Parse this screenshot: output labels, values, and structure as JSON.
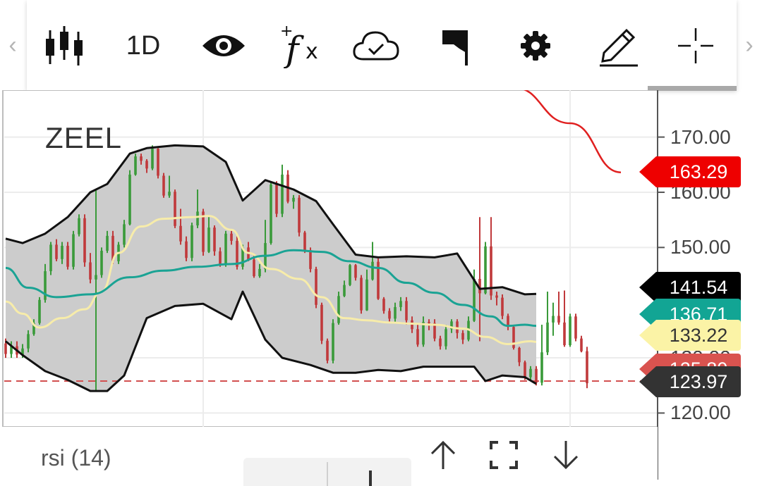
{
  "toolbar": {
    "timeframe": "1D",
    "items": [
      {
        "name": "chart-type-candles-icon"
      },
      {
        "name": "timeframe-button"
      },
      {
        "name": "visibility-eye-icon"
      },
      {
        "name": "add-indicator-fx-icon"
      },
      {
        "name": "cloud-saved-icon"
      },
      {
        "name": "flag-icon"
      },
      {
        "name": "settings-gear-icon"
      },
      {
        "name": "draw-pencil-icon"
      },
      {
        "name": "crosshair-icon"
      }
    ]
  },
  "symbol": "ZEEL",
  "bottom": {
    "indicator_label": "rsi (14)"
  },
  "colors": {
    "band_fill": "#cccccc",
    "band_line": "#111111",
    "ma_teal": "#1aa394",
    "ma_yellow": "#f7ecaa",
    "up": "#3a9a3a",
    "down": "#c0393b",
    "red_line": "#e02020",
    "dashed": "#d25050"
  },
  "chart_data": {
    "type": "candlestick",
    "symbol": "ZEEL",
    "timeframe": "1D",
    "ylim": [
      117.5,
      178.5
    ],
    "y_ticks": [
      "170.00",
      "160.00",
      "150.00",
      "130.00",
      "120.00"
    ],
    "y_tick_values": [
      170,
      160,
      150,
      130,
      120
    ],
    "grid": true,
    "price_tags": [
      {
        "label": "163.29",
        "value": 163.29,
        "bg": "#ee0000",
        "fg": "#ffffff"
      },
      {
        "label": "141.54",
        "value": 141.54,
        "bg": "#000000",
        "fg": "#ffffff"
      },
      {
        "label": "136.71",
        "value": 136.71,
        "bg": "#12a594",
        "fg": "#ffffff"
      },
      {
        "label": "133.22",
        "value": 133.22,
        "bg": "#fbf3a6",
        "fg": "#333333"
      },
      {
        "label": "125.80",
        "value": 125.8,
        "bg": "#d9534f",
        "fg": "#ffffff"
      },
      {
        "label": "123.97",
        "value": 123.97,
        "bg": "#333333",
        "fg": "#ffffff"
      }
    ],
    "dashed_level": 125.8,
    "red_ma": [
      [
        90,
        179
      ],
      [
        100,
        172.5
      ],
      [
        109,
        163.6
      ]
    ],
    "bb_upper": [
      [
        0,
        151.6
      ],
      [
        3,
        150.8
      ],
      [
        7,
        152.5
      ],
      [
        11,
        155.5
      ],
      [
        15,
        160
      ],
      [
        18,
        161.5
      ],
      [
        22,
        167
      ],
      [
        25,
        168
      ],
      [
        30,
        168.5
      ],
      [
        35,
        168.3
      ],
      [
        39,
        165.5
      ],
      [
        42,
        158.5
      ],
      [
        46,
        162.2
      ],
      [
        51,
        160.5
      ],
      [
        55,
        158.4
      ],
      [
        58,
        154.2
      ],
      [
        62,
        148.7
      ],
      [
        66,
        148.2
      ],
      [
        71,
        148.4
      ],
      [
        76,
        148.2
      ],
      [
        80,
        148.9
      ],
      [
        84,
        142.5
      ],
      [
        88,
        142.8
      ],
      [
        92,
        141.5
      ],
      [
        94,
        141.6
      ]
    ],
    "bb_lower": [
      [
        0,
        133
      ],
      [
        3,
        130.5
      ],
      [
        7,
        127.6
      ],
      [
        11,
        126
      ],
      [
        15,
        124
      ],
      [
        18,
        124
      ],
      [
        21,
        126.8
      ],
      [
        25,
        137.2
      ],
      [
        30,
        139.4
      ],
      [
        35,
        139.8
      ],
      [
        40,
        137
      ],
      [
        42,
        142
      ],
      [
        46,
        133.3
      ],
      [
        49,
        130
      ],
      [
        54,
        128.7
      ],
      [
        58,
        127.3
      ],
      [
        62,
        127.3
      ],
      [
        66,
        127.8
      ],
      [
        70,
        127.6
      ],
      [
        74,
        128.4
      ],
      [
        80,
        128.4
      ],
      [
        83,
        128.4
      ],
      [
        85,
        125.8
      ],
      [
        88,
        126.8
      ],
      [
        92,
        126.5
      ],
      [
        94,
        125.3
      ]
    ],
    "ma_teal": [
      [
        0,
        146.3
      ],
      [
        4,
        142.7
      ],
      [
        9,
        141
      ],
      [
        15,
        141.5
      ],
      [
        22,
        144.6
      ],
      [
        28,
        145.8
      ],
      [
        34,
        146.5
      ],
      [
        40,
        147
      ],
      [
        46,
        148.5
      ],
      [
        51,
        149.5
      ],
      [
        56,
        149.2
      ],
      [
        61,
        147.5
      ],
      [
        66,
        146.3
      ],
      [
        71,
        143.6
      ],
      [
        76,
        141.8
      ],
      [
        81,
        139.6
      ],
      [
        86,
        137.5
      ],
      [
        89,
        135.8
      ],
      [
        92,
        136
      ],
      [
        94,
        135.8
      ]
    ],
    "ma_yellow": [
      [
        0,
        140.2
      ],
      [
        3,
        138
      ],
      [
        6,
        135.5
      ],
      [
        10,
        137.2
      ],
      [
        14,
        138.8
      ],
      [
        17,
        142
      ],
      [
        20,
        149
      ],
      [
        24,
        153.8
      ],
      [
        28,
        155.2
      ],
      [
        33,
        155.5
      ],
      [
        36,
        155.7
      ],
      [
        40,
        153.2
      ],
      [
        43,
        149
      ],
      [
        47,
        146.1
      ],
      [
        52,
        144.3
      ],
      [
        56,
        141
      ],
      [
        60,
        137.2
      ],
      [
        64,
        136.8
      ],
      [
        68,
        136.4
      ],
      [
        72,
        136.2
      ],
      [
        76,
        136
      ],
      [
        81,
        135.3
      ],
      [
        85,
        133.8
      ],
      [
        89,
        132.5
      ],
      [
        93,
        133
      ],
      [
        94,
        132.9
      ]
    ],
    "candles": [
      [
        0,
        132.6,
        130.7,
        133.5,
        130
      ],
      [
        1,
        130.7,
        132.1,
        133,
        130
      ],
      [
        2,
        132.1,
        130.6,
        133,
        130
      ],
      [
        3,
        130.6,
        131.7,
        132.5,
        130
      ],
      [
        4,
        131.7,
        134.3,
        135,
        131
      ],
      [
        5,
        134.3,
        136.3,
        137,
        134
      ],
      [
        6,
        136.3,
        140.5,
        141,
        136
      ],
      [
        7,
        140.5,
        145.7,
        147,
        140
      ],
      [
        8,
        145.7,
        150.5,
        151,
        145
      ],
      [
        9,
        150.5,
        147.9,
        151.5,
        147.5
      ],
      [
        10,
        147.9,
        150.3,
        151,
        147
      ],
      [
        11,
        150.3,
        146.5,
        151,
        146
      ],
      [
        12,
        146.5,
        152.4,
        153,
        146
      ],
      [
        13,
        152.4,
        155.3,
        156,
        152
      ],
      [
        14,
        155.3,
        147.3,
        156,
        146.5
      ],
      [
        15,
        147.3,
        144.2,
        149,
        143.5
      ],
      [
        16,
        144.2,
        145,
        160.5,
        124
      ],
      [
        17,
        145,
        149.4,
        150,
        144.5
      ],
      [
        18,
        149.4,
        152.1,
        153,
        149
      ],
      [
        19,
        152.1,
        147.5,
        153,
        147
      ],
      [
        20,
        147.5,
        150.5,
        151,
        147
      ],
      [
        21,
        150.5,
        154.2,
        155,
        150
      ],
      [
        22,
        154.2,
        163.2,
        164,
        154
      ],
      [
        23,
        163.2,
        166.5,
        167,
        163
      ],
      [
        24,
        166.5,
        165.7,
        167,
        165
      ],
      [
        25,
        165.7,
        164.3,
        166,
        163.5
      ],
      [
        26,
        164.3,
        167.9,
        168.5,
        164
      ],
      [
        27,
        167.9,
        163,
        168,
        162.5
      ],
      [
        28,
        163,
        159.4,
        163.5,
        159
      ],
      [
        29,
        159.4,
        160.1,
        163,
        159
      ],
      [
        30,
        160.1,
        153.9,
        160.5,
        153.5
      ],
      [
        31,
        153.9,
        151.1,
        157,
        150.5
      ],
      [
        32,
        151.1,
        148.1,
        152,
        147.5
      ],
      [
        33,
        148.1,
        154,
        154.5,
        147.5
      ],
      [
        34,
        154,
        156.5,
        160.5,
        153.5
      ],
      [
        35,
        156.5,
        149.2,
        157,
        148.5
      ],
      [
        36,
        149.2,
        153.6,
        155.5,
        149
      ],
      [
        37,
        153.6,
        149.3,
        154,
        148.5
      ],
      [
        38,
        149.3,
        146.8,
        150,
        146.5
      ],
      [
        39,
        146.8,
        152.5,
        153,
        146.5
      ],
      [
        40,
        152.5,
        151.2,
        153,
        150.5
      ],
      [
        41,
        151.2,
        146.5,
        152,
        146
      ],
      [
        42,
        146.5,
        150,
        150.5,
        146
      ],
      [
        43,
        150,
        147.8,
        151,
        147.5
      ],
      [
        44,
        147.8,
        144.8,
        148.5,
        144.5
      ],
      [
        45,
        144.8,
        146.1,
        147,
        144.5
      ],
      [
        46,
        146.1,
        150.8,
        155,
        145.5
      ],
      [
        47,
        150.8,
        161.4,
        162,
        150.5
      ],
      [
        48,
        161.4,
        156.1,
        162,
        155.5
      ],
      [
        49,
        156.1,
        163.2,
        165,
        155.5
      ],
      [
        50,
        163.2,
        158.3,
        164,
        158
      ],
      [
        51,
        158.3,
        159,
        159.5,
        157
      ],
      [
        52,
        159,
        152.7,
        159.5,
        152
      ],
      [
        53,
        152.7,
        149.5,
        153,
        149
      ],
      [
        54,
        149.5,
        146.1,
        150,
        145.5
      ],
      [
        55,
        146.1,
        139.6,
        146.5,
        139
      ],
      [
        56,
        139.6,
        133.1,
        140,
        132.5
      ],
      [
        57,
        133.1,
        129.5,
        133.5,
        129
      ],
      [
        58,
        129.5,
        136.3,
        137,
        129
      ],
      [
        59,
        136.3,
        141.2,
        142,
        136
      ],
      [
        60,
        141.2,
        143.2,
        144,
        141
      ],
      [
        61,
        143.2,
        146.8,
        147,
        143
      ],
      [
        62,
        146.8,
        144.5,
        147,
        144
      ],
      [
        63,
        144.5,
        138.6,
        145,
        138
      ],
      [
        64,
        138.6,
        144.2,
        146,
        138.5
      ],
      [
        65,
        144.2,
        147.4,
        151,
        144
      ],
      [
        66,
        147.4,
        140.7,
        148,
        140.5
      ],
      [
        67,
        140.7,
        138.5,
        141,
        138
      ],
      [
        68,
        138.5,
        137.1,
        139,
        136.5
      ],
      [
        69,
        137.1,
        139.2,
        140,
        136.5
      ],
      [
        70,
        139.2,
        140.3,
        141,
        138.5
      ],
      [
        71,
        140.3,
        136.8,
        141,
        136
      ],
      [
        72,
        136.8,
        135.2,
        137.5,
        134.5
      ],
      [
        73,
        135.2,
        132.4,
        136,
        132
      ],
      [
        74,
        132.4,
        136.5,
        137.5,
        132
      ],
      [
        75,
        136.5,
        136.3,
        137,
        135
      ],
      [
        76,
        136.3,
        133.5,
        137,
        133
      ],
      [
        77,
        133.5,
        132.1,
        134,
        131.5
      ],
      [
        78,
        132.1,
        135.2,
        136,
        131.5
      ],
      [
        79,
        135.2,
        136.6,
        137,
        134.5
      ],
      [
        80,
        136.6,
        134.5,
        137,
        133.5
      ],
      [
        81,
        134.5,
        133.3,
        135,
        132.5
      ],
      [
        82,
        133.3,
        136.7,
        137.5,
        133
      ],
      [
        83,
        136.7,
        144.3,
        146,
        136.5
      ],
      [
        84,
        144.3,
        141.7,
        155.5,
        133
      ],
      [
        85,
        141.7,
        150.2,
        151,
        141.5
      ],
      [
        86,
        150.2,
        141.3,
        155.5,
        140.5
      ],
      [
        87,
        141.3,
        140.9,
        142,
        139.5
      ],
      [
        88,
        140.9,
        137.6,
        141.5,
        137
      ],
      [
        89,
        137.6,
        135.6,
        138,
        135
      ],
      [
        90,
        135.6,
        131.8,
        136,
        131.5
      ],
      [
        91,
        131.8,
        129.2,
        132,
        128.5
      ],
      [
        92,
        129.2,
        126.5,
        129.5,
        126
      ],
      [
        93,
        126.5,
        128,
        128.5,
        126
      ],
      [
        94,
        128,
        125.5,
        128.5,
        125
      ],
      [
        95,
        125.5,
        131,
        136,
        125
      ],
      [
        96,
        131,
        136.4,
        142,
        130.5
      ],
      [
        97,
        136.4,
        137.6,
        140,
        134
      ],
      [
        98,
        137.6,
        136.4,
        142,
        136
      ],
      [
        99,
        136.4,
        132.3,
        142.2,
        132
      ],
      [
        100,
        132.3,
        137.5,
        138,
        132
      ],
      [
        101,
        137.5,
        133.5,
        138,
        133
      ],
      [
        102,
        133.5,
        131.2,
        134,
        131
      ],
      [
        103,
        131.2,
        125.4,
        132,
        124.5
      ]
    ]
  }
}
